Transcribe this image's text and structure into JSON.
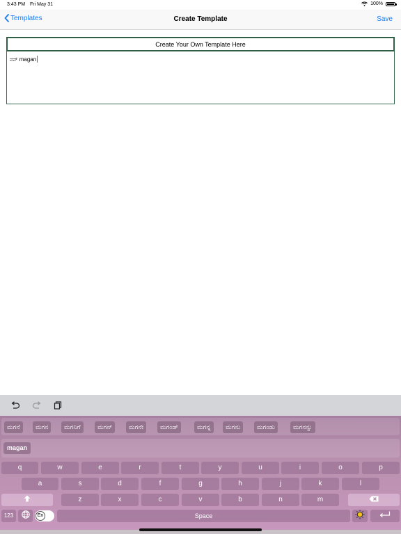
{
  "status_bar": {
    "time": "3:43 PM",
    "date": "Fri May 31",
    "battery": "100%",
    "wifi_icon": "wifi-icon",
    "battery_level": 1.0
  },
  "nav": {
    "back_label": "Templates",
    "title": "Create Template",
    "save_label": "Save"
  },
  "template": {
    "title": "Create Your Own Template Here",
    "body_text": "ನನ್ magan"
  },
  "toolbar": {
    "icons": [
      "undo-icon",
      "redo-icon",
      "paste-icon"
    ]
  },
  "keyboard": {
    "suggestions": [
      "ಮಗನೆ",
      "ಮಗನ",
      "ಮಗನಿಗೆ",
      "ಮಗನ್",
      "ಮಗನೇ",
      "ಮಗಂಡ್",
      "ಮಗನ್ನ",
      "ಮಗನು",
      "ಮಗಂಡು",
      "ಮಗನನ್ನು"
    ],
    "typed": "magan",
    "row1": [
      "q",
      "w",
      "e",
      "r",
      "t",
      "y",
      "u",
      "i",
      "o",
      "p"
    ],
    "row2": [
      "a",
      "s",
      "d",
      "f",
      "g",
      "h",
      "j",
      "k",
      "l"
    ],
    "row3": [
      "z",
      "x",
      "c",
      "v",
      "b",
      "n",
      "m"
    ],
    "numbers_label": "123",
    "lang_label": "En",
    "space_label": "Space",
    "colors": {
      "keyboard_top": "#a77fa0",
      "keyboard_bottom": "#c797bd"
    }
  },
  "colors": {
    "accent": "#1a7cf5",
    "title_border": "#2e5e45"
  }
}
